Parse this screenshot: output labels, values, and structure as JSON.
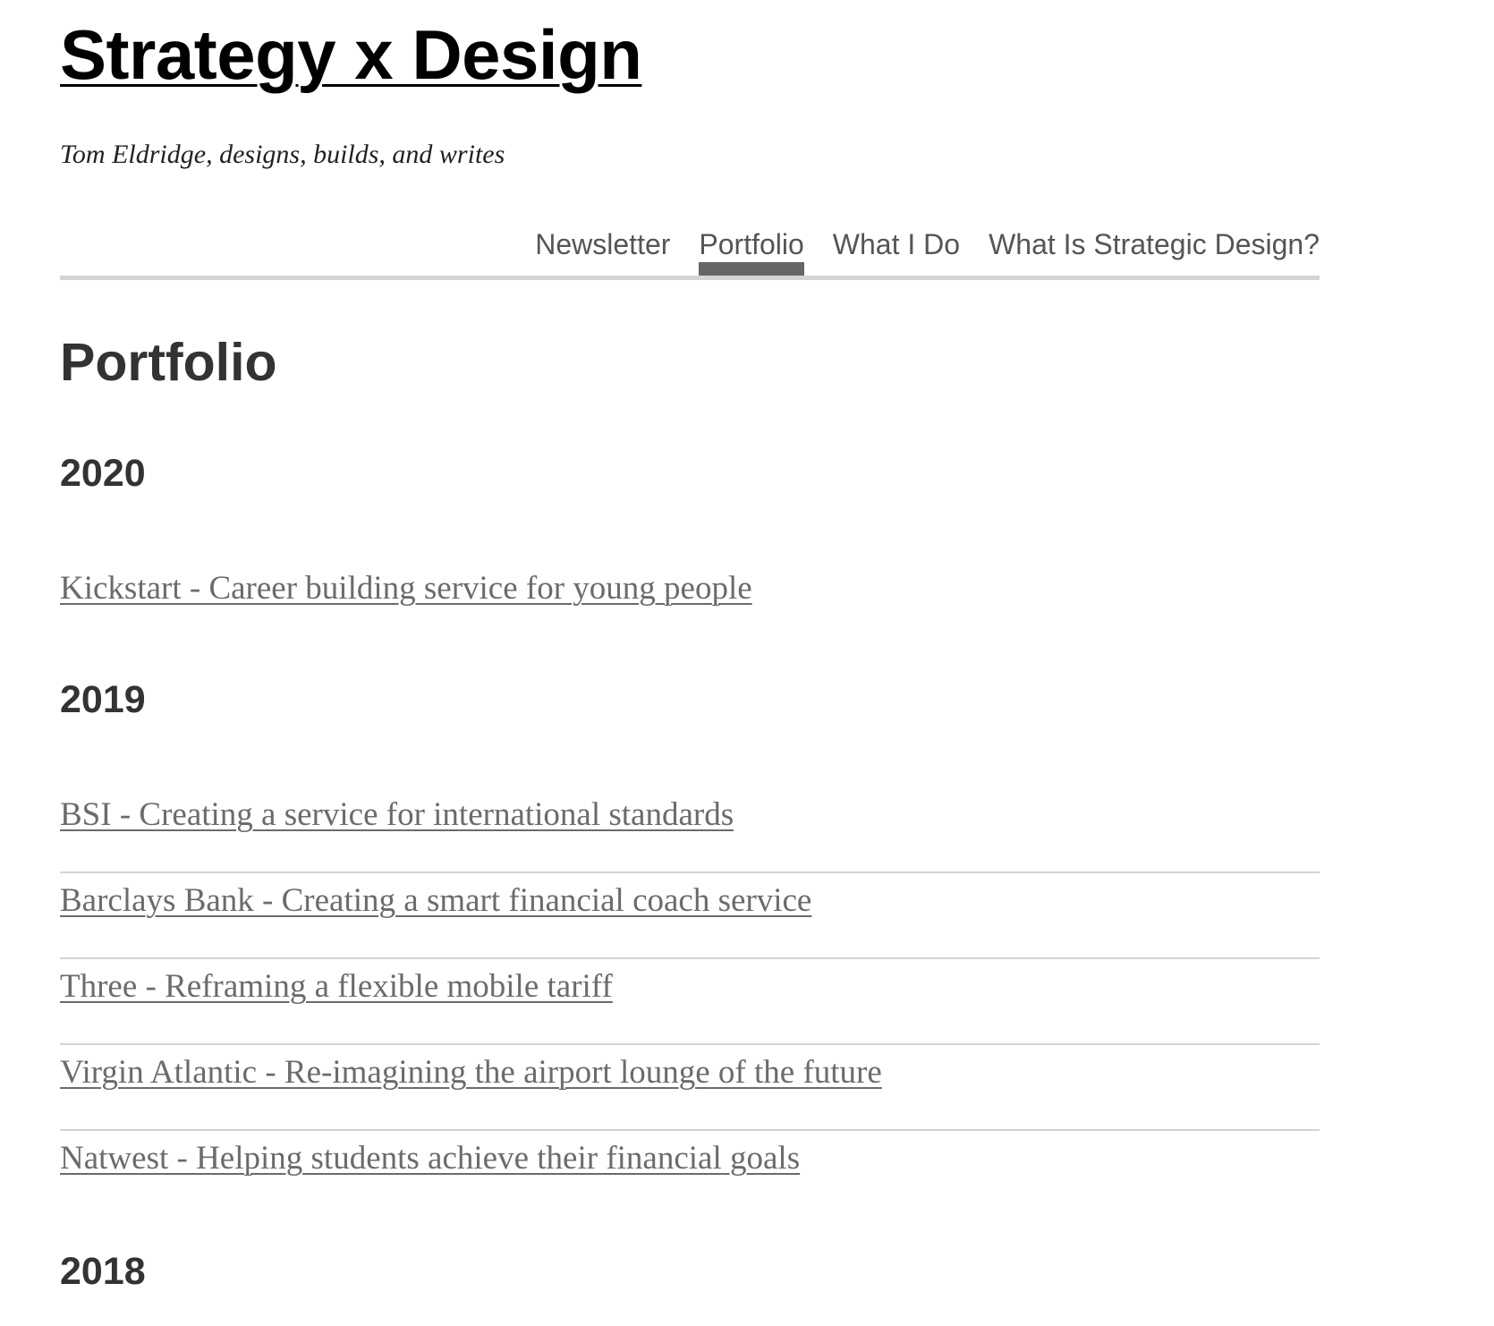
{
  "site": {
    "title": "Strategy x Design",
    "tagline": "Tom Eldridge, designs, builds, and writes"
  },
  "nav": {
    "items": [
      {
        "label": "Newsletter",
        "active": false
      },
      {
        "label": "Portfolio",
        "active": true
      },
      {
        "label": "What I Do",
        "active": false
      },
      {
        "label": "What Is Strategic Design?",
        "active": false
      }
    ]
  },
  "main": {
    "heading": "Portfolio",
    "sections": [
      {
        "year": "2020",
        "projects": [
          "Kickstart - Career building service for young people"
        ]
      },
      {
        "year": "2019",
        "projects": [
          "BSI - Creating a service for international standards",
          "Barclays Bank - Creating a smart financial coach service",
          "Three - Reframing a flexible mobile tariff",
          "Virgin Atlantic - Re-imagining the airport lounge of the future",
          "Natwest - Helping students achieve their financial goals"
        ]
      },
      {
        "year": "2018",
        "projects": []
      }
    ]
  },
  "colors": {
    "title": "#000000",
    "text": "#333333",
    "link": "#6b6b6b",
    "nav_text": "#555555",
    "nav_active_bar": "#666666",
    "rule": "#d4d4d4",
    "background": "#ffffff"
  }
}
